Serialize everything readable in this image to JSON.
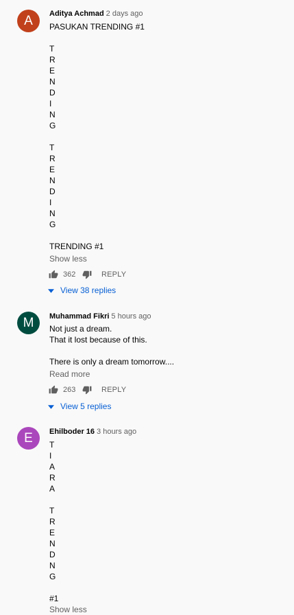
{
  "comments": [
    {
      "avatar_letter": "A",
      "avatar_color": "#c1411c",
      "author": "Aditya Achmad",
      "time": "2 days ago",
      "text": "PASUKAN TRENDING #1\n\nT\nR\nE\nN\nD\nI\nN\nG\n\nT\nR\nE\nN\nD\nI\nN\nG\n\nTRENDING #1",
      "toggle": "Show less",
      "likes": "362",
      "reply_label": "REPLY",
      "view_replies": "View 38 replies"
    },
    {
      "avatar_letter": "M",
      "avatar_color": "#004d40",
      "author": "Muhammad Fikri",
      "time": "5 hours ago",
      "text": "Not just a dream.\nThat it lost because of this.\n\nThere is only a dream tomorrow....",
      "toggle": "Read more",
      "likes": "263",
      "reply_label": "REPLY",
      "view_replies": "View 5 replies"
    },
    {
      "avatar_letter": "E",
      "avatar_color": "#ab47bc",
      "author": "Ehilboder 16",
      "time": "3 hours ago",
      "text": "T\nI\nA\nR\nA\n\nT\nR\nE\nN\nD\nN\nG\n\n#1",
      "toggle": "Show less"
    }
  ],
  "colors": {
    "background": "#f9f9f9",
    "link_blue": "#065fd4",
    "secondary_text": "#606060"
  }
}
